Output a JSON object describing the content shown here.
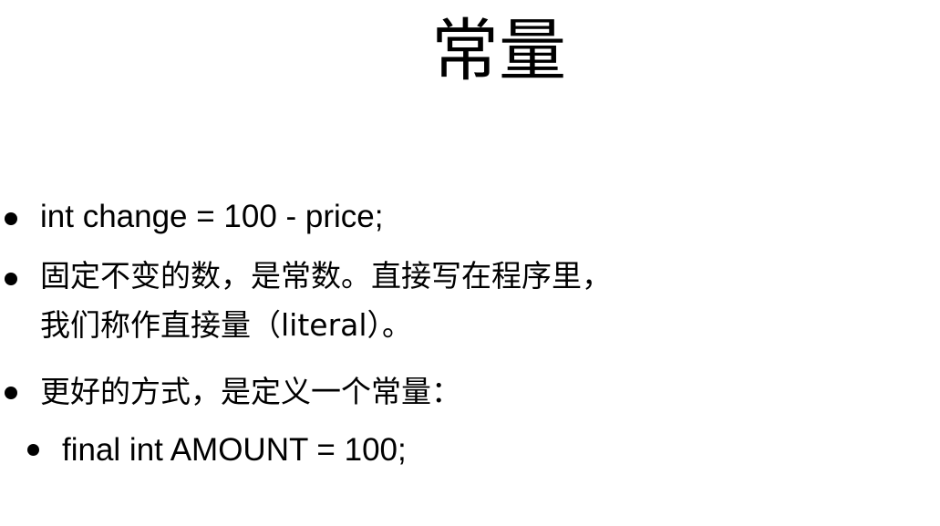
{
  "slide": {
    "title": "常量",
    "bullets": [
      {
        "text": "int change = 100 - price;"
      },
      {
        "line1": "固定不变的数，是常数。直接写在程序里，",
        "line2": "我们称作直接量（literal）。"
      },
      {
        "text": "更好的方式，是定义一个常量："
      },
      {
        "text": "final int AMOUNT = 100;"
      }
    ]
  }
}
